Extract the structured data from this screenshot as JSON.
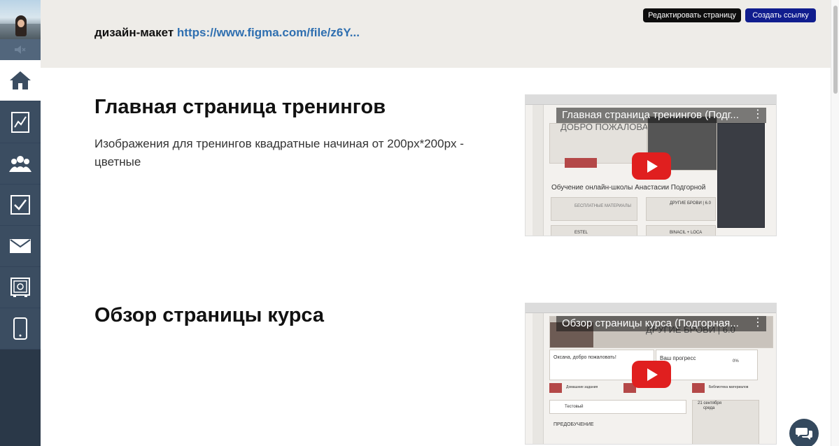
{
  "header": {
    "design_label": "дизайн-макет",
    "design_link": "https://www.figma.com/file/z6Y...",
    "edit_button": "Редактировать страницу",
    "create_link_button": "Создать ссылку"
  },
  "sections": [
    {
      "title": "Главная страница тренингов",
      "description": "Изображения для тренингов квадратные начиная от 200px*200px - цветные",
      "video": {
        "title": "Главная страница тренингов (Подг...",
        "screen_heading": "ДОБРО ПОЖАЛОВАТЬ",
        "screen_subheading": "Обучение онлайн-школы Анастасии Подгорной",
        "card_1": "БЕСПЛАТНЫЕ МАТЕРИАЛЫ",
        "card_2": "ДРУГИЕ БРОВИ | 6.0",
        "card_3": "ESTEL",
        "card_4": "BINACIL + LOCA"
      }
    },
    {
      "title": "Обзор страницы курса",
      "description": "",
      "video": {
        "title": "Обзор страницы курса (Подгорная...",
        "screen_heading": "ДРУГИЕ БРОВИ | 6.0",
        "greeting": "Оксана, добро пожаловать!",
        "progress_label": "Ваш прогресс",
        "progress_value": "0%",
        "tile_1": "Домашние задания",
        "tile_2": "Библиотека материалов",
        "search_label": "Тестовый",
        "calendar_date": "21 сентября",
        "calendar_day": "среда",
        "pre_training": "ПРЕДОБУЧЕНИЕ"
      }
    }
  ],
  "icons": {
    "mute": "volume-mute-icon",
    "home": "home-icon",
    "chart": "chart-icon",
    "users": "users-icon",
    "tasks": "checkbox-icon",
    "mail": "mail-icon",
    "safe": "safe-icon",
    "mobile": "mobile-icon",
    "chat": "chat-icon"
  },
  "colors": {
    "sidebar": "#3b4d61",
    "header_band": "#eeece8",
    "link": "#2f6fb0",
    "edit_button": "#0d0d0d",
    "create_button": "#101d8e",
    "play_button": "#e01f1f",
    "chat_button": "#34495e"
  }
}
